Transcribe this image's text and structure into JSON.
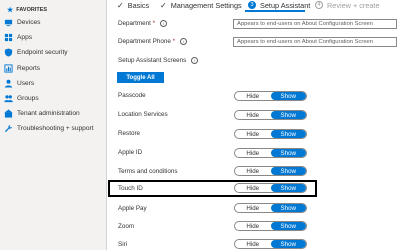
{
  "sidebar": {
    "favorites_label": "FAVORITES",
    "items": [
      {
        "label": "Devices",
        "icon": "devices-icon",
        "color": "#0078d4"
      },
      {
        "label": "Apps",
        "icon": "apps-icon",
        "color": "#0078d4"
      },
      {
        "label": "Endpoint security",
        "icon": "shield-icon",
        "color": "#0078d4"
      },
      {
        "label": "Reports",
        "icon": "reports-icon",
        "color": "#0078d4"
      },
      {
        "label": "Users",
        "icon": "user-icon",
        "color": "#0078d4"
      },
      {
        "label": "Groups",
        "icon": "groups-icon",
        "color": "#0078d4"
      },
      {
        "label": "Tenant administration",
        "icon": "tenant-icon",
        "color": "#0078d4"
      },
      {
        "label": "Troubleshooting + support",
        "icon": "troubleshoot-icon",
        "color": "#0078d4"
      }
    ]
  },
  "tabs": [
    {
      "label": "Basics",
      "state": "done"
    },
    {
      "label": "Management Settings",
      "state": "done"
    },
    {
      "number": "3",
      "label": "Setup Assistant",
      "state": "active"
    },
    {
      "number": "4",
      "label": "Review + create",
      "state": "inactive"
    }
  ],
  "form": {
    "department_label": "Department",
    "department_placeholder": "Appears to end-users on About Configuration Screen",
    "department_phone_label": "Department Phone",
    "department_phone_placeholder": "Appears to end-users on About Configuration Screen",
    "screens_label": "Setup Assistant Screens",
    "toggle_all_label": "Toggle All",
    "required_mark": "*",
    "info_glyph": "i"
  },
  "toggle_labels": {
    "hide": "Hide",
    "show": "Show"
  },
  "screens": [
    {
      "label": "Passcode",
      "selected": "Show"
    },
    {
      "label": "Location Services",
      "selected": "Show"
    },
    {
      "label": "Restore",
      "selected": "Show"
    },
    {
      "label": "Apple ID",
      "selected": "Show"
    },
    {
      "label": "Terms and conditions",
      "selected": "Show"
    },
    {
      "label": "Touch ID",
      "selected": "Show",
      "highlighted": true
    },
    {
      "label": "Apple Pay",
      "selected": "Show"
    },
    {
      "label": "Zoom",
      "selected": "Show"
    },
    {
      "label": "Siri",
      "selected": "Show"
    }
  ],
  "colors": {
    "accent": "#0078d4",
    "highlight_border": "#000000"
  }
}
